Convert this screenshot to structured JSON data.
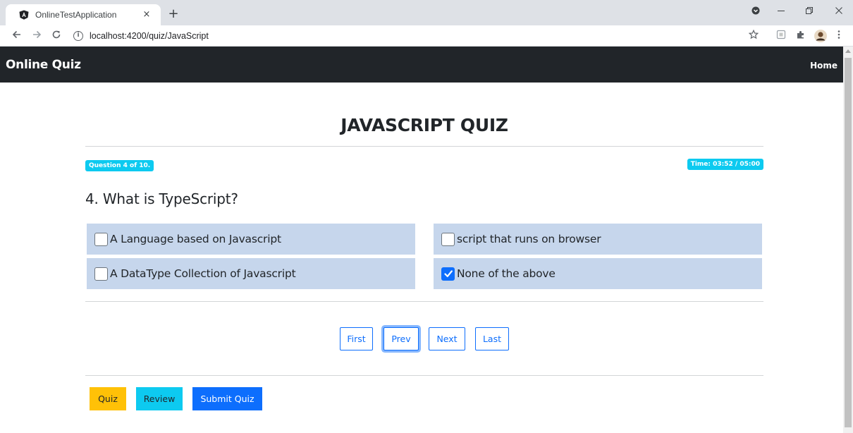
{
  "browser": {
    "tab_title": "OnlineTestApplication",
    "tab_close": "×",
    "new_tab": "+",
    "url": "localhost:4200/quiz/JavaScript",
    "icons": [
      "angular-favicon",
      "back-arrow-icon",
      "forward-arrow-icon",
      "reload-icon",
      "info-icon",
      "star-icon",
      "extension-icon",
      "puzzle-icon",
      "profile-avatar",
      "kebab-menu-icon",
      "minimize-icon",
      "restore-icon",
      "close-icon"
    ]
  },
  "navbar": {
    "brand": "Online Quiz",
    "home": "Home"
  },
  "quiz": {
    "title": "JAVASCRIPT QUIZ",
    "question_counter": "Question 4 of 10.",
    "timer": "Time: 03:52 / 05:00",
    "question": "4. What is TypeScript?",
    "options": [
      {
        "label": "A Language based on Javascript",
        "checked": false
      },
      {
        "label": "script that runs on browser",
        "checked": false
      },
      {
        "label": "A DataType Collection of Javascript",
        "checked": false
      },
      {
        "label": "None of the above",
        "checked": true
      }
    ]
  },
  "pager": {
    "first": "First",
    "prev": "Prev",
    "next": "Next",
    "last": "Last"
  },
  "actions": {
    "quiz": "Quiz",
    "review": "Review",
    "submit": "Submit Quiz"
  },
  "colors": {
    "navbar": "#212529",
    "badge": "#0dcaf0",
    "option_bg": "#c6d6ec",
    "primary": "#0d6efd",
    "warning": "#ffc107",
    "info": "#0dcaf0"
  }
}
